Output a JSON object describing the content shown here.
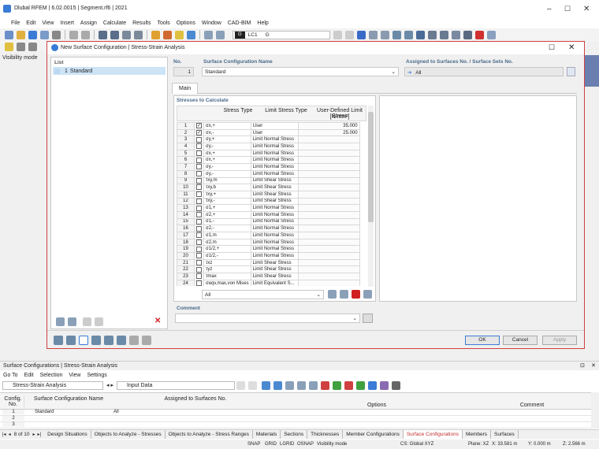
{
  "app": {
    "title": "Dlubal RFEM | 6.02.0015 | Segment.rf6 | 2021"
  },
  "menu": [
    "File",
    "Edit",
    "View",
    "Insert",
    "Assign",
    "Calculate",
    "Results",
    "Tools",
    "Options",
    "Window",
    "CAD-BIM",
    "Help"
  ],
  "toolbar": {
    "lc_code": "G",
    "lc_name": "LC1",
    "lc_value": "G"
  },
  "sidebar": {
    "visibility_label": "Visibility mode"
  },
  "dialog": {
    "title": "New Surface Configuration | Stress-Strain Analysis",
    "list_label": "List",
    "list_items": [
      {
        "no": "1",
        "name": "Standard"
      }
    ],
    "no_label": "No.",
    "no_value": "1",
    "name_label": "Surface Configuration Name",
    "name_value": "Standard",
    "assigned_label": "Assigned to Surfaces No. / Surface Sets No.",
    "assigned_value": "All",
    "tab_main": "Main",
    "stresses_label": "Stresses to Calculate",
    "col_stress": "Stress Type",
    "col_limit": "Limit Stress Type",
    "col_user": "User-Defined Limit Stress",
    "col_unit": "[N/mm²]",
    "rows": [
      {
        "no": "1",
        "checked": true,
        "stress": "σx,+",
        "limit": "User",
        "value": "35.000"
      },
      {
        "no": "2",
        "checked": true,
        "stress": "σx,-",
        "limit": "User",
        "value": "25.000"
      },
      {
        "no": "3",
        "checked": false,
        "stress": "σy,+",
        "limit": "Limit Normal Stress",
        "value": ""
      },
      {
        "no": "4",
        "checked": false,
        "stress": "σy,-",
        "limit": "Limit Normal Stress",
        "value": ""
      },
      {
        "no": "5",
        "checked": false,
        "stress": "σx,+",
        "limit": "Limit Normal Stress",
        "value": ""
      },
      {
        "no": "6",
        "checked": false,
        "stress": "σx,+",
        "limit": "Limit Normal Stress",
        "value": ""
      },
      {
        "no": "7",
        "checked": false,
        "stress": "σy,-",
        "limit": "Limit Normal Stress",
        "value": ""
      },
      {
        "no": "8",
        "checked": false,
        "stress": "σy,-",
        "limit": "Limit Normal Stress",
        "value": ""
      },
      {
        "no": "9",
        "checked": false,
        "stress": "τxy,m",
        "limit": "Limit Shear Stress",
        "value": ""
      },
      {
        "no": "10",
        "checked": false,
        "stress": "τxy,b",
        "limit": "Limit Shear Stress",
        "value": ""
      },
      {
        "no": "11",
        "checked": false,
        "stress": "τxy,+",
        "limit": "Limit Shear Stress",
        "value": ""
      },
      {
        "no": "12",
        "checked": false,
        "stress": "τxy,-",
        "limit": "Limit Shear Stress",
        "value": ""
      },
      {
        "no": "13",
        "checked": false,
        "stress": "σ1,+",
        "limit": "Limit Normal Stress",
        "value": ""
      },
      {
        "no": "14",
        "checked": false,
        "stress": "σ2,+",
        "limit": "Limit Normal Stress",
        "value": ""
      },
      {
        "no": "15",
        "checked": false,
        "stress": "σ1,-",
        "limit": "Limit Normal Stress",
        "value": ""
      },
      {
        "no": "16",
        "checked": false,
        "stress": "σ2,-",
        "limit": "Limit Normal Stress",
        "value": ""
      },
      {
        "no": "17",
        "checked": false,
        "stress": "σ1,m",
        "limit": "Limit Normal Stress",
        "value": ""
      },
      {
        "no": "18",
        "checked": false,
        "stress": "σ2,m",
        "limit": "Limit Normal Stress",
        "value": ""
      },
      {
        "no": "19",
        "checked": false,
        "stress": "σ1/2,+",
        "limit": "Limit Normal Stress",
        "value": ""
      },
      {
        "no": "20",
        "checked": false,
        "stress": "σ1/2,-",
        "limit": "Limit Normal Stress",
        "value": ""
      },
      {
        "no": "21",
        "checked": false,
        "stress": "τxz",
        "limit": "Limit Shear Stress",
        "value": ""
      },
      {
        "no": "22",
        "checked": false,
        "stress": "τyz",
        "limit": "Limit Shear Stress",
        "value": ""
      },
      {
        "no": "23",
        "checked": false,
        "stress": "τmax",
        "limit": "Limit Shear Stress",
        "value": ""
      },
      {
        "no": "24",
        "checked": false,
        "stress": "σeqv,max,von Mises",
        "limit": "Limit Equivalent S...",
        "value": ""
      }
    ],
    "filter_value": "All",
    "comment_label": "Comment",
    "ok": "OK",
    "cancel": "Cancel",
    "apply": "Apply"
  },
  "bottom": {
    "title": "Surface Configurations | Stress-Strain Analysis",
    "menu": [
      "Go To",
      "Edit",
      "Selection",
      "View",
      "Settings"
    ],
    "combo_left": "Stress-Strain Analysis",
    "combo_right": "Input Data",
    "headers": {
      "config_no": "Config. No.",
      "name": "Surface Configuration Name",
      "assigned": "Assigned to Surfaces No.",
      "options": "Options",
      "comment": "Comment"
    },
    "rows": [
      {
        "no": "1",
        "name": "Standard",
        "assigned": "All"
      },
      {
        "no": "2",
        "name": "",
        "assigned": ""
      },
      {
        "no": "3",
        "name": "",
        "assigned": ""
      }
    ],
    "page": "8 of 10",
    "tabs": [
      "Design Situations",
      "Objects to Analyze - Stresses",
      "Objects to Analyze - Stress Ranges",
      "Materials",
      "Sections",
      "Thicknesses",
      "Member Configurations",
      "Surface Configurations",
      "Members",
      "Surfaces"
    ],
    "active_tab": "Surface Configurations"
  },
  "status": {
    "items": [
      "SNAP",
      "GRID",
      "LGRID",
      "OSNAP",
      "Visibility mode"
    ],
    "cs": "CS: Global XYZ",
    "plane": "Plane: XZ",
    "x": "X: 33.581 m",
    "y": "Y: 0.000 m",
    "z": "Z: 2.566 m"
  }
}
